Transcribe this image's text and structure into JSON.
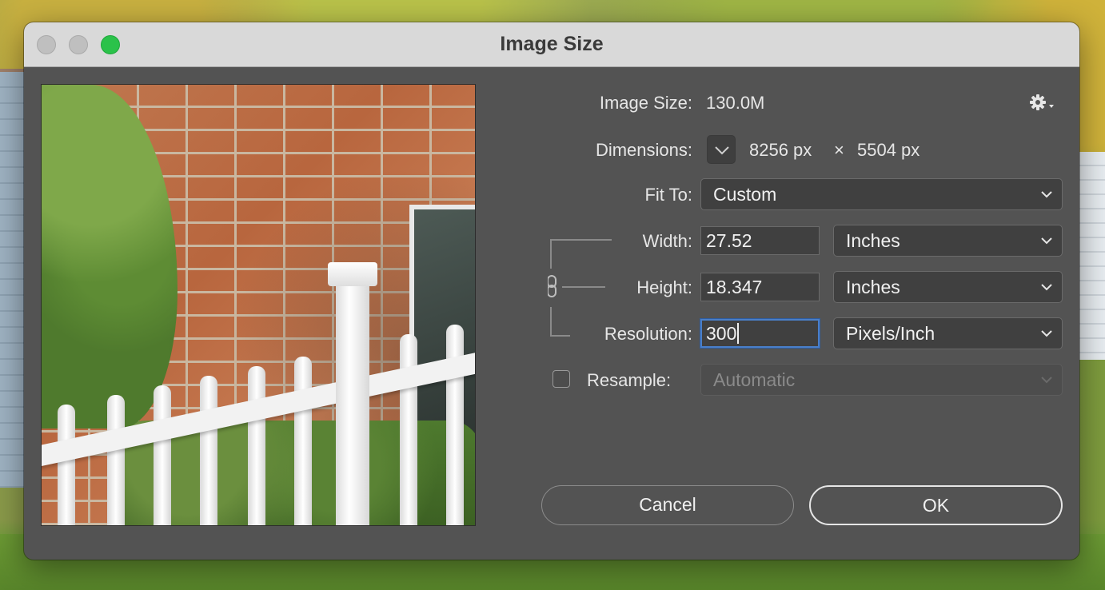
{
  "window": {
    "title": "Image Size"
  },
  "image_size": {
    "label": "Image Size:",
    "value": "130.0M"
  },
  "dimensions": {
    "label": "Dimensions:",
    "width": "8256 px",
    "times": "×",
    "height": "5504 px"
  },
  "fit_to": {
    "label": "Fit To:",
    "value": "Custom"
  },
  "width": {
    "label": "Width:",
    "value": "27.52",
    "unit": "Inches"
  },
  "height": {
    "label": "Height:",
    "value": "18.347",
    "unit": "Inches"
  },
  "resolution": {
    "label": "Resolution:",
    "value": "300",
    "unit": "Pixels/Inch"
  },
  "resample": {
    "label": "Resample:",
    "value": "Automatic",
    "checked": false
  },
  "buttons": {
    "cancel": "Cancel",
    "ok": "OK"
  },
  "colors": {
    "focus_ring": "#4a7fc9",
    "zoom_button": "#2bc24a",
    "dialog_bg": "#535353"
  }
}
